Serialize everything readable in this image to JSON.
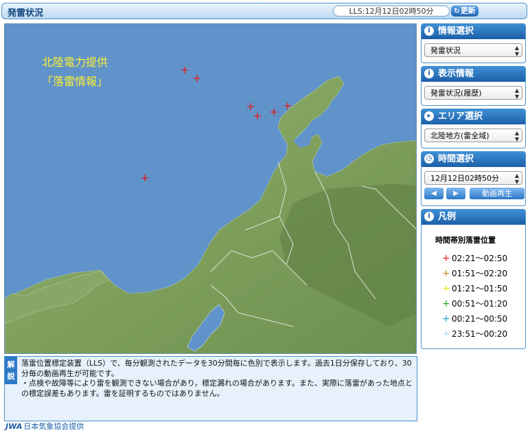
{
  "header": {
    "title": "発雷状況",
    "lls_time": "LLS:12月12日02時50分",
    "refresh_label": "更新"
  },
  "map": {
    "provider_line1": "北陸電力提供",
    "provider_line2": "「落雷情報」",
    "strikes": [
      {
        "period": 0
      },
      {
        "period": 0
      },
      {
        "period": 0
      },
      {
        "period": 0
      },
      {
        "period": 0
      },
      {
        "period": 0
      },
      {
        "period": 0
      }
    ]
  },
  "panels": {
    "info_select": {
      "title": "情報選択",
      "value": "発雷状況"
    },
    "display_info": {
      "title": "表示情報",
      "value": "発雷状況(履歴)"
    },
    "area_select": {
      "title": "エリア選択",
      "value": "北陸地方(雷全域)"
    },
    "time_select": {
      "title": "時間選択",
      "value": "12月12日02時50分",
      "prev": "◀",
      "next": "▶",
      "play_label": "動画再生"
    },
    "legend": {
      "title": "凡例",
      "subtitle": "時間帯別落雷位置",
      "items": [
        {
          "label": "02:21〜02:50",
          "color": "#e02020"
        },
        {
          "label": "01:51〜02:20",
          "color": "#c88a28"
        },
        {
          "label": "01:21〜01:50",
          "color": "#e6e61a"
        },
        {
          "label": "00:51〜01:20",
          "color": "#22aa22"
        },
        {
          "label": "00:21〜00:50",
          "color": "#2a9fd8"
        },
        {
          "label": "23:51〜00:20",
          "color": "#a8dcf0"
        }
      ]
    }
  },
  "description": {
    "tag": "解説",
    "text1": "落雷位置標定装置（LLS）で、毎分観測されたデータを30分間毎に色別で表示します。過去1日分保存しており、30分毎の動画再生が可能です。",
    "text2": "・点検や故障等により雷を観測できない場合があり，標定漏れの場合があります。また、実際に落雷があった地点との標定誤差もあります。雷を証明するものではありません。"
  },
  "footer": {
    "logo": "JWA",
    "text": "日本気象協会提供"
  }
}
